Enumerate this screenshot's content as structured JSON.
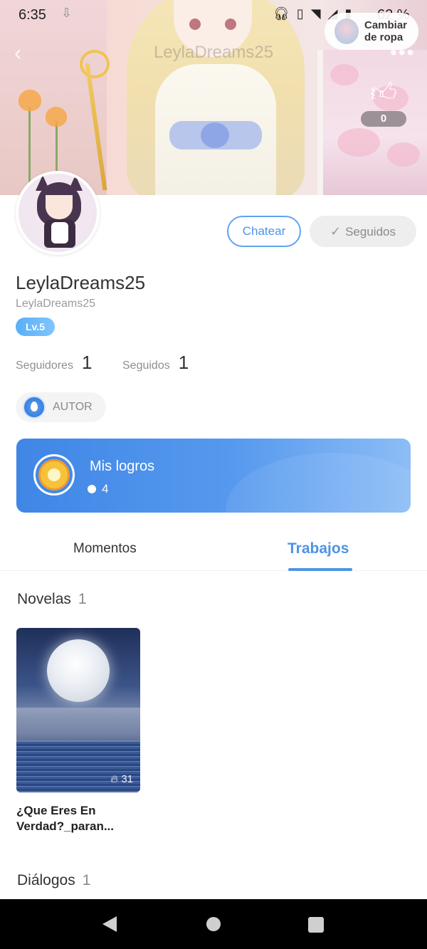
{
  "status_bar": {
    "time": "6:35",
    "battery": "62 %",
    "icons": [
      "download-icon",
      "headphones-icon",
      "vibrate-icon",
      "wifi-icon",
      "signal-icon",
      "battery-icon"
    ]
  },
  "header": {
    "title": "LeylaDreams25",
    "change_outfit_label": "Cambiar\nde ropa",
    "like_count": "0"
  },
  "profile": {
    "buttons": {
      "chat": "Chatear",
      "following": "Seguidos"
    },
    "display_name": "LeylaDreams25",
    "handle": "LeylaDreams25",
    "level": "Lv.5",
    "stats": {
      "followers_label": "Seguidores",
      "followers_count": "1",
      "following_label": "Seguidos",
      "following_count": "1"
    },
    "role_badge": "AUTOR"
  },
  "achievements": {
    "title": "Mis logros",
    "count": "4"
  },
  "tabs": [
    {
      "label": "Momentos",
      "active": false
    },
    {
      "label": "Trabajos",
      "active": true
    }
  ],
  "sections": {
    "novels": {
      "title": "Novelas",
      "count": "1",
      "items": [
        {
          "title": "¿Que Eres En Verdad?_paran...",
          "likes": "31"
        }
      ]
    },
    "dialogs": {
      "title": "Diálogos",
      "count": "1"
    }
  },
  "colors": {
    "accent": "#4d94e6",
    "achievement_gradient_start": "#3f86e6",
    "achievement_gradient_end": "#8cbdf6",
    "level_badge": "#5aaef5"
  }
}
